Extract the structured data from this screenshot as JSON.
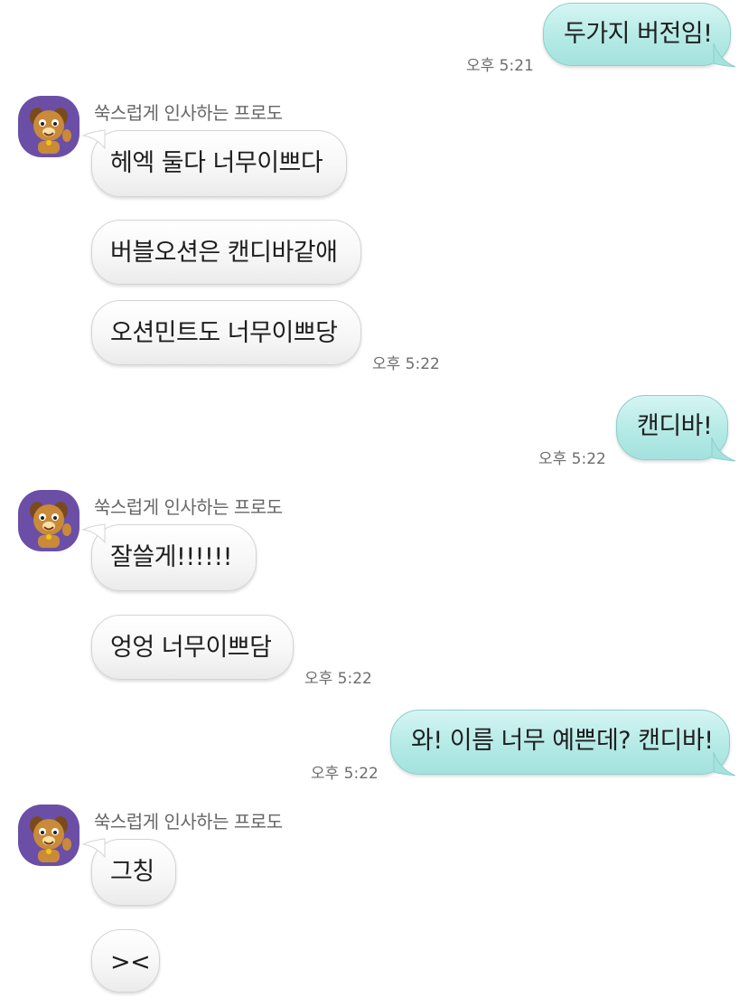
{
  "colors": {
    "outgoing_bubble": "#b7ebe7",
    "incoming_bubble": "#f5f5f5",
    "avatar_bg": "#6b4fa6"
  },
  "messages": [
    {
      "dir": "out",
      "text": "두가지 버전임!",
      "time": "오후 5:21"
    },
    {
      "dir": "in",
      "sender": "쑥스럽게 인사하는 프로도",
      "avatar": "frodo-dog-avatar",
      "texts": [
        "헤엑 둘다 너무이쁘다",
        "버블오션은 캔디바같애",
        "오션민트도 너무이쁘당"
      ],
      "time": "오후 5:22"
    },
    {
      "dir": "out",
      "text": "캔디바!",
      "time": "오후 5:22"
    },
    {
      "dir": "in",
      "sender": "쑥스럽게 인사하는 프로도",
      "avatar": "frodo-dog-avatar",
      "texts": [
        "잘쓸게!!!!!!",
        "엉엉 너무이쁘담"
      ],
      "time": "오후 5:22"
    },
    {
      "dir": "out",
      "text": "와! 이름 너무 예쁜데? 캔디바!",
      "time": "오후 5:22"
    },
    {
      "dir": "in",
      "sender": "쑥스럽게 인사하는 프로도",
      "avatar": "frodo-dog-avatar",
      "texts": [
        "그칭",
        "><"
      ]
    }
  ]
}
